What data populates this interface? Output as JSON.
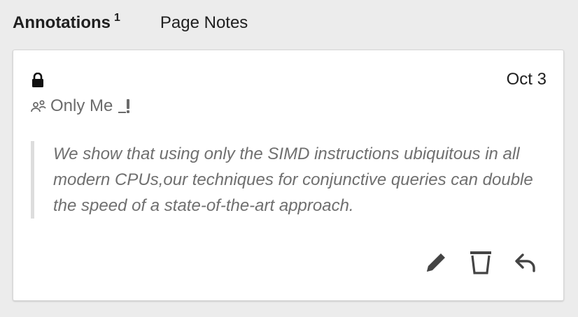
{
  "tabs": {
    "annotations_label": "Annotations",
    "annotations_count": "1",
    "page_notes_label": "Page Notes"
  },
  "annotation": {
    "date": "Oct 3",
    "group": "Only Me",
    "quote": "We show that using only the SIMD instructions ubiquitous in all modern CPUs,our techniques for conjunctive queries can double the speed of a state-of-the-art approach.",
    "icons": {
      "privacy": "lock-icon",
      "group": "group-icon",
      "warning": "warning-icon",
      "edit": "pencil-icon",
      "delete": "trash-icon",
      "reply": "reply-icon"
    }
  },
  "colors": {
    "background": "#ececec",
    "card": "#ffffff",
    "text": "#202020",
    "muted": "#6b6b6b",
    "quote_border": "#dddddd"
  }
}
